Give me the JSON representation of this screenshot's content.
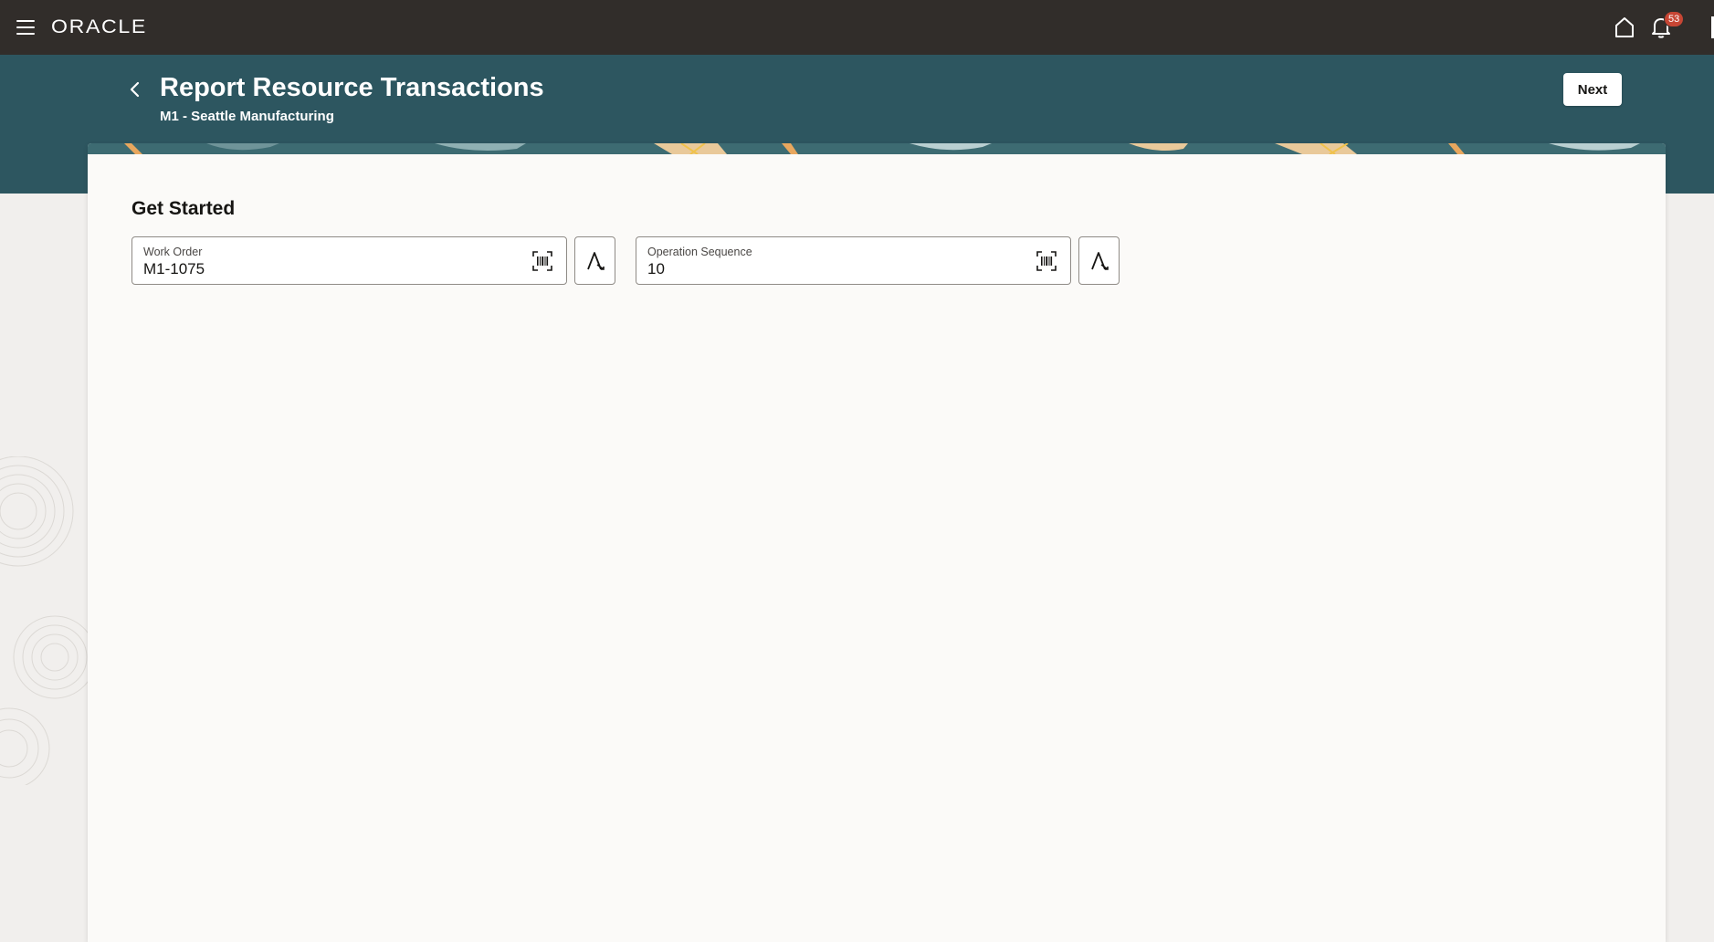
{
  "app": {
    "brand": "ORACLE",
    "notifications_count": "53"
  },
  "header": {
    "title": "Report Resource Transactions",
    "subtitle": "M1 - Seattle Manufacturing",
    "next_label": "Next"
  },
  "main": {
    "section_title": "Get Started",
    "fields": [
      {
        "label": "Work Order",
        "value": "M1-1075"
      },
      {
        "label": "Operation Sequence",
        "value": "10"
      }
    ]
  },
  "colors": {
    "topbar": "#312d2a",
    "header_band": "#2d5660",
    "badge": "#c74634",
    "card": "#fbfaf8"
  }
}
